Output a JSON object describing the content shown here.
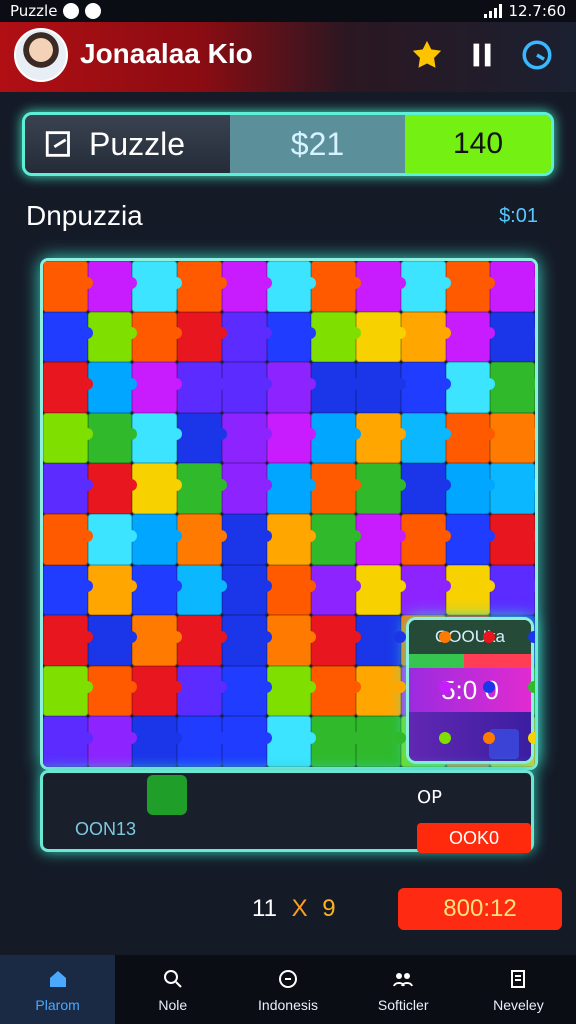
{
  "status": {
    "left": "Puzzle",
    "right": "12.7:60"
  },
  "header": {
    "username": "Jonaalaa Kio"
  },
  "score": {
    "label": "Puzzle",
    "money": "$21",
    "points": "140"
  },
  "section": {
    "title": "Dnpuzzia",
    "value": "$:01"
  },
  "board": {
    "rows": 10,
    "cols": 11,
    "colors": [
      "#ff5a00",
      "#ff7a00",
      "#30b92b",
      "#1f3cff",
      "#8d24ff",
      "#c81cff",
      "#e8171f",
      "#0bb7ff",
      "#f8d100",
      "#7fe000",
      "#3ce4ff",
      "#1b36e8",
      "#5b2bff",
      "#00a6ff",
      "#ffa700"
    ]
  },
  "tray": {
    "label": "OON13",
    "right_label": "OP",
    "button_label": "OOK0"
  },
  "status_panel": {
    "title": "OOOUka",
    "time": "5:0 0"
  },
  "footer": {
    "moves_left": "11",
    "moves_x": "X",
    "moves_right": "9",
    "time_badge": "800:12"
  },
  "nav": {
    "items": [
      {
        "label": "Plarom"
      },
      {
        "label": "Nole"
      },
      {
        "label": "Indonesis"
      },
      {
        "label": "Softicler"
      },
      {
        "label": "Neveley"
      }
    ]
  }
}
